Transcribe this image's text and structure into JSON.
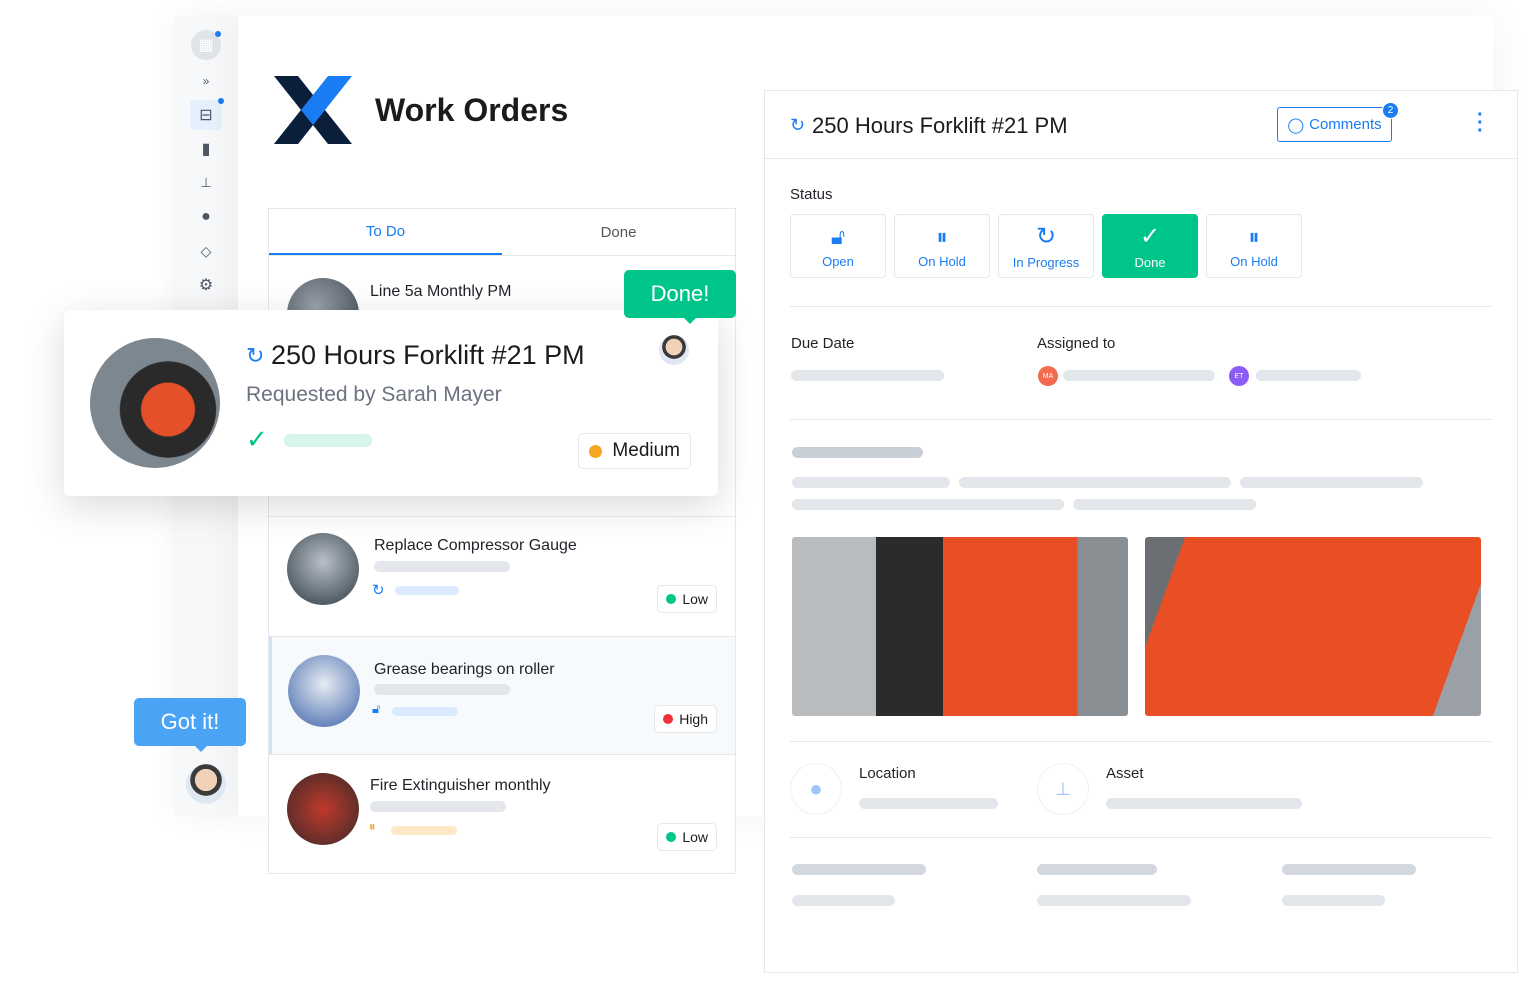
{
  "app": {
    "title": "Work Orders"
  },
  "sidebar": {
    "icons": [
      "building-icon",
      "expand-icon",
      "inbox-icon",
      "bar-chart-icon",
      "hierarchy-icon",
      "chat-icon",
      "tag-icon",
      "gear-icon"
    ]
  },
  "list": {
    "tabs": [
      {
        "label": "To Do",
        "active": true
      },
      {
        "label": "Done",
        "active": false
      }
    ],
    "items": [
      {
        "title": "Line 5a Monthly PM"
      },
      {
        "title": "Replace Compressor Gauge",
        "priority": "Low",
        "priority_color": "#00c58a",
        "status_icon": "refresh-icon"
      },
      {
        "title": "Grease bearings on roller",
        "priority": "High",
        "priority_color": "#f0303a",
        "status_icon": "lock-icon"
      },
      {
        "title": "Fire Extinguisher monthly",
        "priority": "Low",
        "priority_color": "#00c58a",
        "status_icon": "pause-icon"
      }
    ]
  },
  "card": {
    "title": "250 Hours Forklift #21 PM",
    "requested_by": "Requested by Sarah Mayer",
    "priority": "Medium",
    "priority_color": "#f5a623"
  },
  "bubbles": {
    "done": "Done!",
    "got_it": "Got it!"
  },
  "detail": {
    "title": "250 Hours Forklift #21 PM",
    "comments_label": "Comments",
    "comments_count": "2",
    "status_label": "Status",
    "statuses": [
      {
        "label": "Open",
        "icon": "unlock-icon"
      },
      {
        "label": "On Hold",
        "icon": "pause-icon"
      },
      {
        "label": "In Progress",
        "icon": "refresh-icon"
      },
      {
        "label": "Done",
        "icon": "check-icon",
        "selected": true
      },
      {
        "label": "On Hold",
        "icon": "pause-icon"
      }
    ],
    "due_date_label": "Due Date",
    "assigned_label": "Assigned to",
    "assignees": [
      {
        "initials": "MA",
        "color": "#f26b4f"
      },
      {
        "initials": "ET",
        "color": "#8b5cf6"
      }
    ],
    "location_label": "Location",
    "asset_label": "Asset"
  },
  "colors": {
    "accent": "#1a7cf2",
    "done": "#00c58a",
    "brand_dark": "#0b1f3a"
  }
}
